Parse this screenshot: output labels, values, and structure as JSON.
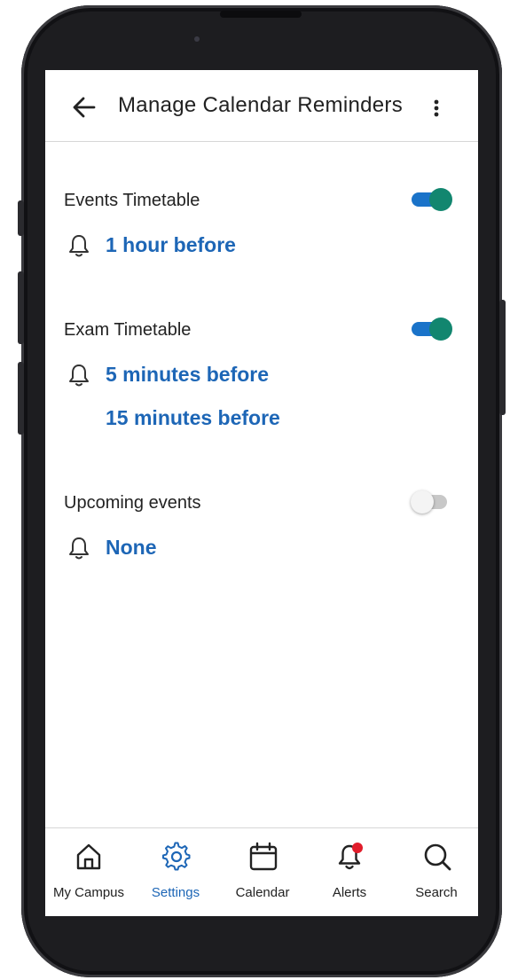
{
  "header": {
    "title": "Manage Calendar Reminders"
  },
  "sections": [
    {
      "title": "Events Timetable",
      "toggle_on": true,
      "reminders": [
        "1 hour before"
      ]
    },
    {
      "title": "Exam Timetable",
      "toggle_on": true,
      "reminders": [
        "5 minutes before",
        "15 minutes before"
      ]
    },
    {
      "title": "Upcoming events",
      "toggle_on": false,
      "reminders": [
        "None"
      ]
    }
  ],
  "bottom_nav": [
    {
      "label": "My Campus",
      "icon": "home-icon",
      "active": false
    },
    {
      "label": "Settings",
      "icon": "gear-icon",
      "active": true
    },
    {
      "label": "Calendar",
      "icon": "calendar-icon",
      "active": false
    },
    {
      "label": "Alerts",
      "icon": "bell-badge-icon",
      "active": false
    },
    {
      "label": "Search",
      "icon": "search-icon",
      "active": false
    }
  ],
  "colors": {
    "accent_text": "#1d66b6",
    "toggle_track_on": "#1a73c9",
    "toggle_thumb_on": "#12866f",
    "alert_badge": "#e11d2b"
  }
}
